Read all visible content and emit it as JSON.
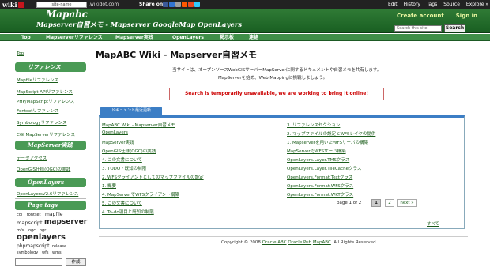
{
  "wikidot": {
    "logo": "wiki",
    "site_input": "site-name",
    "suffix": ".wikidot.com",
    "share_label": "Share on",
    "share_icons": [
      "facebook-icon",
      "delicious-icon",
      "digg-icon",
      "reddit-icon",
      "stumbleupon-icon",
      "twitter-icon"
    ],
    "menu": [
      "Edit",
      "History",
      "Tags",
      "Source",
      "Explore »"
    ]
  },
  "header": {
    "site_name": "Mapabc",
    "subtitle": "Mapserver自習メモ - Mapserver GoogleMap OpenLayers",
    "create_account": "Create account",
    "sign_in": "Sign in",
    "search_placeholder": "Search this site",
    "search_button": "Search"
  },
  "nav": [
    "Top",
    "Mapserverリファレンス",
    "Mapserver実践",
    "OpenLayers",
    "掲示板",
    "連絡"
  ],
  "sidebar": {
    "top": "Top",
    "sec1": "リファレンス",
    "sec1_items": [
      "Mapfileリファレンス",
      "MapScript APIリファレンス",
      "PHP/MapScriptリファレンス",
      "Fontsetリファレンス",
      "Symbologyリファレンス",
      "CGI MapServerリファレンス"
    ],
    "sec2": "MapServer実践",
    "sec2_items": [
      "データアクセス",
      "OpenGIS仕様(OGC)の実践"
    ],
    "sec3": "OpenLayers",
    "sec3_items": [
      "OpenLayersV2.6リファレンス"
    ],
    "tags_title": "Page tags",
    "tags": [
      "cgi",
      "fontset",
      "mapfile",
      "mapscript",
      "mapserver",
      "mfs",
      "ogc",
      "ogr",
      "openlayers",
      "phpmapscript",
      "release",
      "symbology",
      "wfs",
      "wms"
    ],
    "create_button": "作成"
  },
  "main": {
    "title": "MapABC Wiki - Mapserver自習メモ",
    "intro1": "当サイトは、オープンソースWebGISサーバーMapServerに関するドキュメントや自習メモを共有します。",
    "intro2": "MapServerを始め、Web Mappingに挑戦しましょう。",
    "alert": "Search is temporarily unavailable, we are working to bring it online!",
    "tab": "ドキュメント最近更新",
    "left_links": [
      "MapABC Wiki - Mapserver自習メモ",
      "OpenLayers",
      "MapServer実践",
      "OpenGIS仕様(OGC)の実践",
      "4. この文書について",
      "3. TODO / 既知の制限",
      "2. WFSクライアントとしてのマップファイルの設定",
      "1. 概要",
      "4. MapServerでWFSクライアント構築",
      "5. この文書について",
      "4. To-do項目と既知の制限"
    ],
    "right_links": [
      "3. リファレンスセクション",
      "2. マップファイルの設定とWFSレイヤの提供",
      "1. Mapserverを用いたWFSサーバの構築",
      "MapServerでWFSサーバ構築",
      "OpenLayers.Layer.TMSクラス",
      "OpenLayers.Layer.TileCacheクラス",
      "OpenLayers.Format.Textクラス",
      "OpenLayers.Format.WFSクラス",
      "OpenLayers.Format.WKTクラス"
    ],
    "page_label": "page 1 of 2",
    "page1": "1",
    "page2": "2",
    "next": "next »",
    "all": "すべて",
    "footer_prefix": "Copyright © 2008",
    "footer_links": [
      "Oracle ABC",
      "Oracle Pub",
      "MapABC"
    ],
    "footer_suffix": ". All Rights Reserved."
  }
}
